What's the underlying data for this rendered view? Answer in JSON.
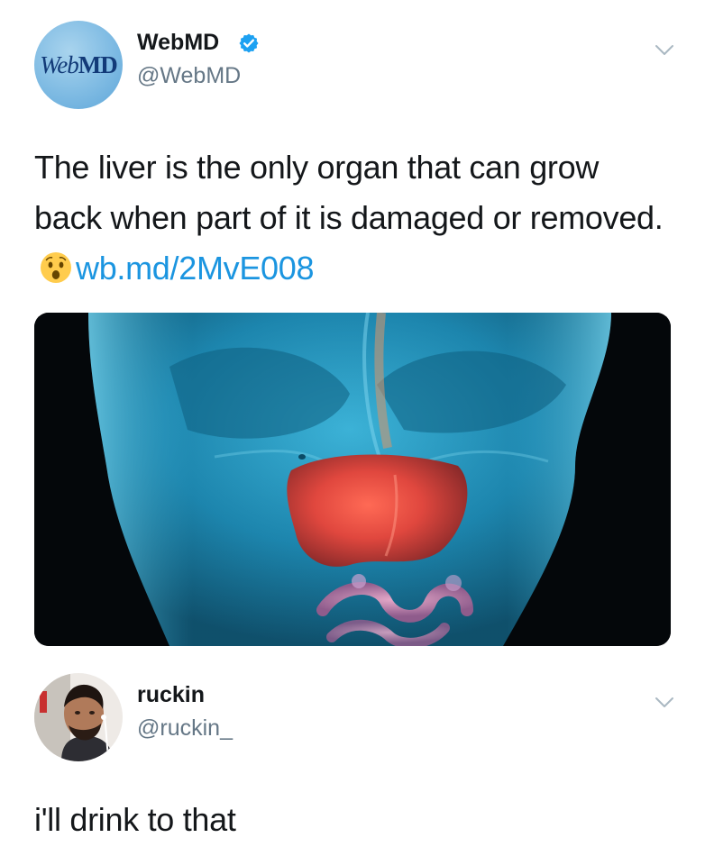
{
  "tweets": [
    {
      "author": {
        "name": "WebMD",
        "handle": "@WebMD",
        "verified": true,
        "avatar_text_web": "Web",
        "avatar_text_md": "MD"
      },
      "text": "The liver is the only organ that can grow back when part of it is damaged or removed.",
      "emoji": "hushed-face-emoji",
      "link": "wb.md/2MvE008",
      "media": "illustration of a translucent blue human torso with the liver highlighted in red"
    },
    {
      "author": {
        "name": "ruckin",
        "handle": "@ruckin_",
        "verified": false
      },
      "text": "i'll drink to that"
    }
  ],
  "colors": {
    "link": "#1b95e0",
    "verified": "#1da1f2",
    "handle": "#657786",
    "text": "#14171a",
    "chevron": "#aab8c2"
  }
}
